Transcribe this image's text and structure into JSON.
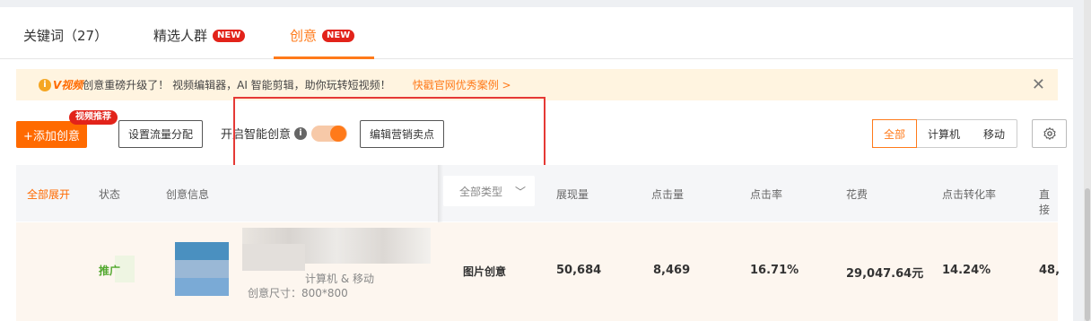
{
  "tabs": [
    {
      "label": "关键词（27）",
      "badge": ""
    },
    {
      "label": "精选人群",
      "badge": "NEW"
    },
    {
      "label": "创意",
      "badge": "NEW"
    }
  ],
  "notice": {
    "brand": "V视频",
    "text": "创意重磅升级了！ 视频编辑器，AI 智能剪辑，助你玩转短视频！",
    "link": "快戳官网优秀案例 >",
    "close": "✕"
  },
  "toolbar": {
    "add_label": "+添加创意",
    "add_badge": "视频推荐",
    "flow_label": "设置流量分配",
    "smart_label": "开启智能创意",
    "smart_enabled": true,
    "edit_label": "编辑营销卖点"
  },
  "device_filter": {
    "options": [
      "全部",
      "计算机",
      "移动"
    ],
    "selected": "全部"
  },
  "table": {
    "headers": {
      "expand": "全部展开",
      "status": "状态",
      "info": "创意信息",
      "type_select": "全部类型",
      "impressions": "展现量",
      "clicks": "点击量",
      "ctr": "点击率",
      "cost": "花费",
      "cvr": "点击转化率",
      "direct": "直接"
    },
    "row": {
      "status": "推广",
      "device": "计算机 & 移动",
      "size": "创意尺寸：800*800",
      "type": "图片创意",
      "impressions": "50,684",
      "clicks": "8,469",
      "ctr": "16.71%",
      "cost": "29,047.64元",
      "cvr": "14.24%",
      "direct": "48,"
    }
  },
  "colors": {
    "accent": "#ff7a1a",
    "badge_red": "#e2231a",
    "annotation_red": "#e53935",
    "status_green": "#52a82e"
  }
}
